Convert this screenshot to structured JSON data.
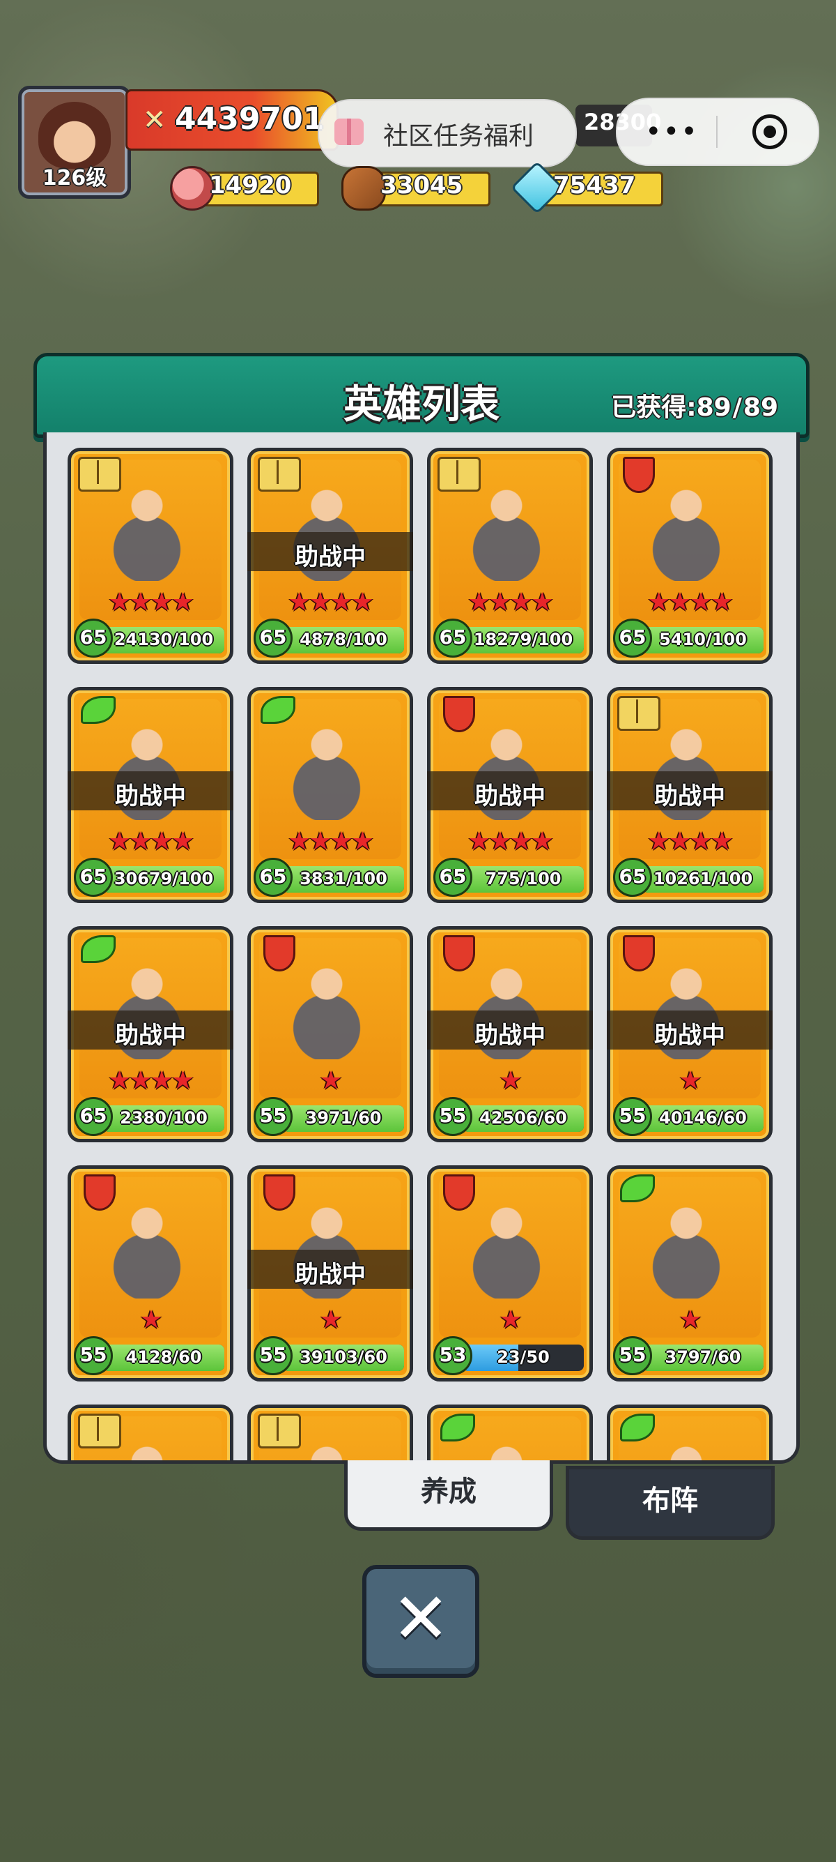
{
  "player": {
    "level_label": "126级",
    "power": "4439701"
  },
  "community": {
    "label": "社区任务福利"
  },
  "gems_top": "28300",
  "capsule": {
    "menu_label": "•••"
  },
  "resources": [
    {
      "name": "meat",
      "value": "14920",
      "icon": "meat-icon"
    },
    {
      "name": "wood",
      "value": "33045",
      "icon": "wood-icon"
    },
    {
      "name": "crystal",
      "value": "75437",
      "icon": "crystal-icon"
    }
  ],
  "panel": {
    "title": "英雄列表",
    "obtained_label": "已获得:",
    "obtained": "89",
    "total": "89"
  },
  "support_label": "助战中",
  "heroes": [
    {
      "badge": "book",
      "stars": "★★★★",
      "level": "65",
      "progress": "24130/100",
      "fill": 1.0,
      "support": false
    },
    {
      "badge": "book",
      "stars": "★★★★",
      "level": "65",
      "progress": "4878/100",
      "fill": 1.0,
      "support": true
    },
    {
      "badge": "book",
      "stars": "★★★★",
      "level": "65",
      "progress": "18279/100",
      "fill": 1.0,
      "support": false
    },
    {
      "badge": "red",
      "stars": "★★★★",
      "level": "65",
      "progress": "5410/100",
      "fill": 1.0,
      "support": false
    },
    {
      "badge": "green",
      "stars": "★★★★",
      "level": "65",
      "progress": "30679/100",
      "fill": 1.0,
      "support": true
    },
    {
      "badge": "green",
      "stars": "★★★★",
      "level": "65",
      "progress": "3831/100",
      "fill": 1.0,
      "support": false
    },
    {
      "badge": "red",
      "stars": "★★★★",
      "level": "65",
      "progress": "775/100",
      "fill": 1.0,
      "support": true
    },
    {
      "badge": "book",
      "stars": "★★★★",
      "level": "65",
      "progress": "10261/100",
      "fill": 1.0,
      "support": true
    },
    {
      "badge": "green",
      "stars": "★★★★",
      "level": "65",
      "progress": "2380/100",
      "fill": 1.0,
      "support": true
    },
    {
      "badge": "red",
      "stars": "★",
      "level": "55",
      "progress": "3971/60",
      "fill": 1.0,
      "support": false
    },
    {
      "badge": "red",
      "stars": "★",
      "level": "55",
      "progress": "42506/60",
      "fill": 1.0,
      "support": true
    },
    {
      "badge": "red",
      "stars": "★",
      "level": "55",
      "progress": "40146/60",
      "fill": 1.0,
      "support": true
    },
    {
      "badge": "red",
      "stars": "★",
      "level": "55",
      "progress": "4128/60",
      "fill": 1.0,
      "support": false
    },
    {
      "badge": "red",
      "stars": "★",
      "level": "55",
      "progress": "39103/60",
      "fill": 1.0,
      "support": true
    },
    {
      "badge": "red",
      "stars": "★",
      "level": "53",
      "progress": "23/50",
      "fill": 0.46,
      "support": false,
      "blue": true
    },
    {
      "badge": "green",
      "stars": "★",
      "level": "55",
      "progress": "3797/60",
      "fill": 1.0,
      "support": false
    },
    {
      "badge": "book",
      "stars": "",
      "level": "",
      "progress": "",
      "fill": 0,
      "support": false
    },
    {
      "badge": "book",
      "stars": "",
      "level": "",
      "progress": "",
      "fill": 0,
      "support": false
    },
    {
      "badge": "green",
      "stars": "",
      "level": "",
      "progress": "",
      "fill": 0,
      "support": false
    },
    {
      "badge": "green",
      "stars": "",
      "level": "",
      "progress": "",
      "fill": 0,
      "support": false
    }
  ],
  "tabs": {
    "develop": "养成",
    "formation": "布阵"
  },
  "close": {
    "label": "✕"
  }
}
